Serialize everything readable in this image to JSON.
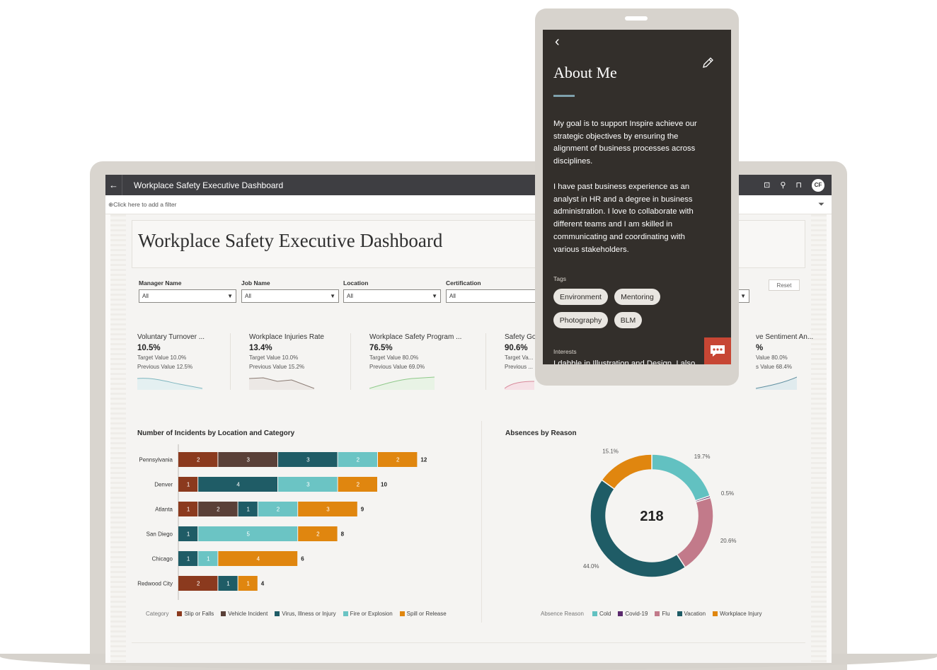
{
  "app": {
    "title": "Workplace Safety Executive Dashboard",
    "filter_hint": "Click here to add a filter",
    "avatar_initials": "CF"
  },
  "dashboard": {
    "title": "Workplace Safety Executive Dashboard",
    "reset_label": "Reset",
    "filters": [
      {
        "label": "Manager Name",
        "value": "All"
      },
      {
        "label": "Job Name",
        "value": "All"
      },
      {
        "label": "Location",
        "value": "All"
      },
      {
        "label": "Certification",
        "value": "All"
      }
    ],
    "kpis": [
      {
        "name": "Voluntary Turnover ...",
        "value": "10.5%",
        "target": "Target Value  10.0%",
        "previous": "Previous Value  12.5%",
        "color": "#7fb6bf"
      },
      {
        "name": "Workplace Injuries Rate",
        "value": "13.4%",
        "target": "Target Value  10.0%",
        "previous": "Previous Value  15.2%",
        "color": "#8a7a72"
      },
      {
        "name": "Workplace Safety Program ...",
        "value": "76.5%",
        "target": "Target Value  80.0%",
        "previous": "Previous Value  69.0%",
        "color": "#8fc98a"
      },
      {
        "name": "Safety Go",
        "value": "90.6%",
        "target": "Target Va...",
        "previous": "Previous ...",
        "color": "#d88a9b"
      },
      {
        "name": "ve Sentiment An...",
        "value": "%",
        "target": "Value  80.0%",
        "previous": "s Value  68.4%",
        "color": "#5f8fa0"
      }
    ]
  },
  "chart_data": [
    {
      "type": "bar",
      "title": "Number of Incidents by Location and Category",
      "legend_label": "Category",
      "categories": [
        "Pennsylvania",
        "Denver",
        "Atlanta",
        "San Diego",
        "Chicago",
        "Redwood City"
      ],
      "totals": [
        12,
        10,
        9,
        8,
        6,
        4
      ],
      "series": [
        {
          "name": "Slip or Falls",
          "color": "#8b3a1e",
          "values": [
            2,
            1,
            1,
            0,
            0,
            2
          ]
        },
        {
          "name": "Vehicle Incident",
          "color": "#5a4038",
          "values": [
            3,
            0,
            2,
            0,
            0,
            0
          ]
        },
        {
          "name": "Virus, Illness or Injury",
          "color": "#1f5c66",
          "values": [
            3,
            4,
            1,
            1,
            1,
            1
          ]
        },
        {
          "name": "Fire or Explosion",
          "color": "#6bc4c4",
          "values": [
            2,
            3,
            2,
            5,
            1,
            0
          ]
        },
        {
          "name": "Spill or Release",
          "color": "#e0860f",
          "values": [
            2,
            2,
            3,
            2,
            4,
            1
          ]
        }
      ]
    },
    {
      "type": "pie",
      "title": "Absences by Reason",
      "legend_label": "Absence Reason",
      "center_label": "218",
      "slices": [
        {
          "name": "Cold",
          "value": 19.7,
          "label": "19.7%",
          "color": "#62c1c1"
        },
        {
          "name": "Covid-19",
          "value": 0.5,
          "label": "0.5%",
          "color": "#5b2a6e"
        },
        {
          "name": "Flu",
          "value": 20.6,
          "label": "20.6%",
          "color": "#c27a8a"
        },
        {
          "name": "Vacation",
          "value": 44.0,
          "label": "44.0%",
          "color": "#1f5c66"
        },
        {
          "name": "Workplace Injury",
          "value": 15.1,
          "label": "15.1%",
          "color": "#e0860f"
        }
      ]
    }
  ],
  "phone": {
    "title": "About Me",
    "para1": "My goal is to support Inspire achieve our strategic objectives by ensuring the alignment of business processes across disciplines.",
    "para2": "I have past business experience as an analyst in HR and a degree in business administration.  I love to collaborate with different teams and I am skilled in communicating and coordinating with various stakeholders.",
    "tags_label": "Tags",
    "tags": [
      "Environment",
      "Mentoring",
      "Photography",
      "BLM"
    ],
    "interests_label": "Interests",
    "interests_text": "I dabble in Illustration and Design. I also"
  }
}
